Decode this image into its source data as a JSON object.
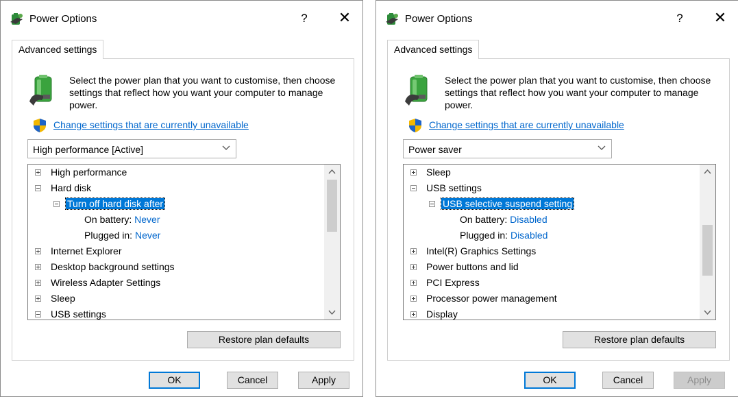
{
  "left": {
    "title": "Power Options",
    "help": "?",
    "close": "✕",
    "tab": "Advanced settings",
    "description": "Select the power plan that you want to customise, then choose settings that reflect how you want your computer to manage power.",
    "change_link": "Change settings that are currently unavailable",
    "plan": "High performance [Active]",
    "tree": {
      "r1": "High performance",
      "r2": "Hard disk",
      "r3": "Turn off hard disk after",
      "r4_label": "On battery:",
      "r4_value": "Never",
      "r5_label": "Plugged in:",
      "r5_value": "Never",
      "r6": "Internet Explorer",
      "r7": "Desktop background settings",
      "r8": "Wireless Adapter Settings",
      "r9": "Sleep",
      "r10": "USB settings"
    },
    "restore": "Restore plan defaults",
    "ok": "OK",
    "cancel": "Cancel",
    "apply": "Apply"
  },
  "right": {
    "title": "Power Options",
    "help": "?",
    "close": "✕",
    "tab": "Advanced settings",
    "description": "Select the power plan that you want to customise, then choose settings that reflect how you want your computer to manage power.",
    "change_link": "Change settings that are currently unavailable",
    "plan": "Power saver",
    "tree": {
      "r1": "Sleep",
      "r2": "USB settings",
      "r3": "USB selective suspend setting",
      "r4_label": "On battery:",
      "r4_value": "Disabled",
      "r5_label": "Plugged in:",
      "r5_value": "Disabled",
      "r6": "Intel(R) Graphics Settings",
      "r7": "Power buttons and lid",
      "r8": "PCI Express",
      "r9": "Processor power management",
      "r10": "Display"
    },
    "restore": "Restore plan defaults",
    "ok": "OK",
    "cancel": "Cancel",
    "apply": "Apply",
    "apply_disabled": true
  },
  "colors": {
    "selection": "#0078d7",
    "link": "#0066cc",
    "button_face": "#e1e1e1",
    "scrollbar_thumb": "#cdcdcd"
  }
}
